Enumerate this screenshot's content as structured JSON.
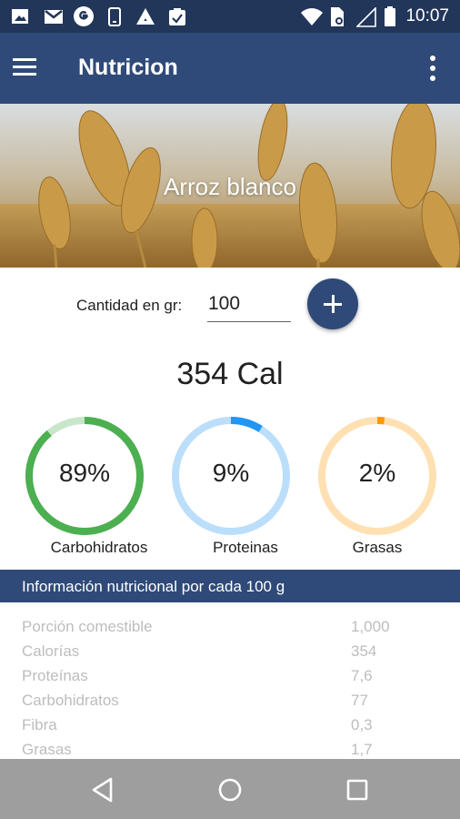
{
  "status_bar": {
    "time": "10:07",
    "icons": [
      "image-icon",
      "gmail-icon",
      "google-icon",
      "phone-icon",
      "drive-icon",
      "clipboard-check-icon",
      "wifi-icon",
      "sim-icon",
      "signal-icon",
      "battery-icon"
    ]
  },
  "app_bar": {
    "title": "Nutricion",
    "menu_icon": "hamburger-menu-icon",
    "more_icon": "more-vert-icon"
  },
  "hero": {
    "food_name": "Arroz blanco",
    "background": "wheat-field-image"
  },
  "quantity": {
    "label": "Cantidad en gr:",
    "value": "100",
    "add_icon": "plus-icon"
  },
  "calories": "354 Cal",
  "macros": [
    {
      "label": "Carbohidratos",
      "percent_text": "89%",
      "percent": 89,
      "color": "#4caf50",
      "track_color": "#c8e6c9"
    },
    {
      "label": "Proteinas",
      "percent_text": "9%",
      "percent": 9,
      "color": "#2196f3",
      "track_color": "#bbdefb"
    },
    {
      "label": "Grasas",
      "percent_text": "2%",
      "percent": 2,
      "color": "#ff9800",
      "track_color": "#ffe0b2"
    }
  ],
  "info": {
    "header": "Información nutricional por cada 100 g",
    "rows": [
      {
        "label": "Porción comestible",
        "value": "1,000"
      },
      {
        "label": "Calorías",
        "value": "354"
      },
      {
        "label": "Proteínas",
        "value": "7,6"
      },
      {
        "label": "Carbohidratos",
        "value": "77"
      },
      {
        "label": "Fibra",
        "value": "0,3"
      },
      {
        "label": "Grasas",
        "value": "1,7"
      }
    ]
  },
  "nav_bar": {
    "icons": [
      "back-icon",
      "home-icon",
      "recents-icon"
    ]
  },
  "colors": {
    "primary": "#2f4a78",
    "status_bar": "#22365a",
    "nav_bar": "#9e9e9e"
  }
}
